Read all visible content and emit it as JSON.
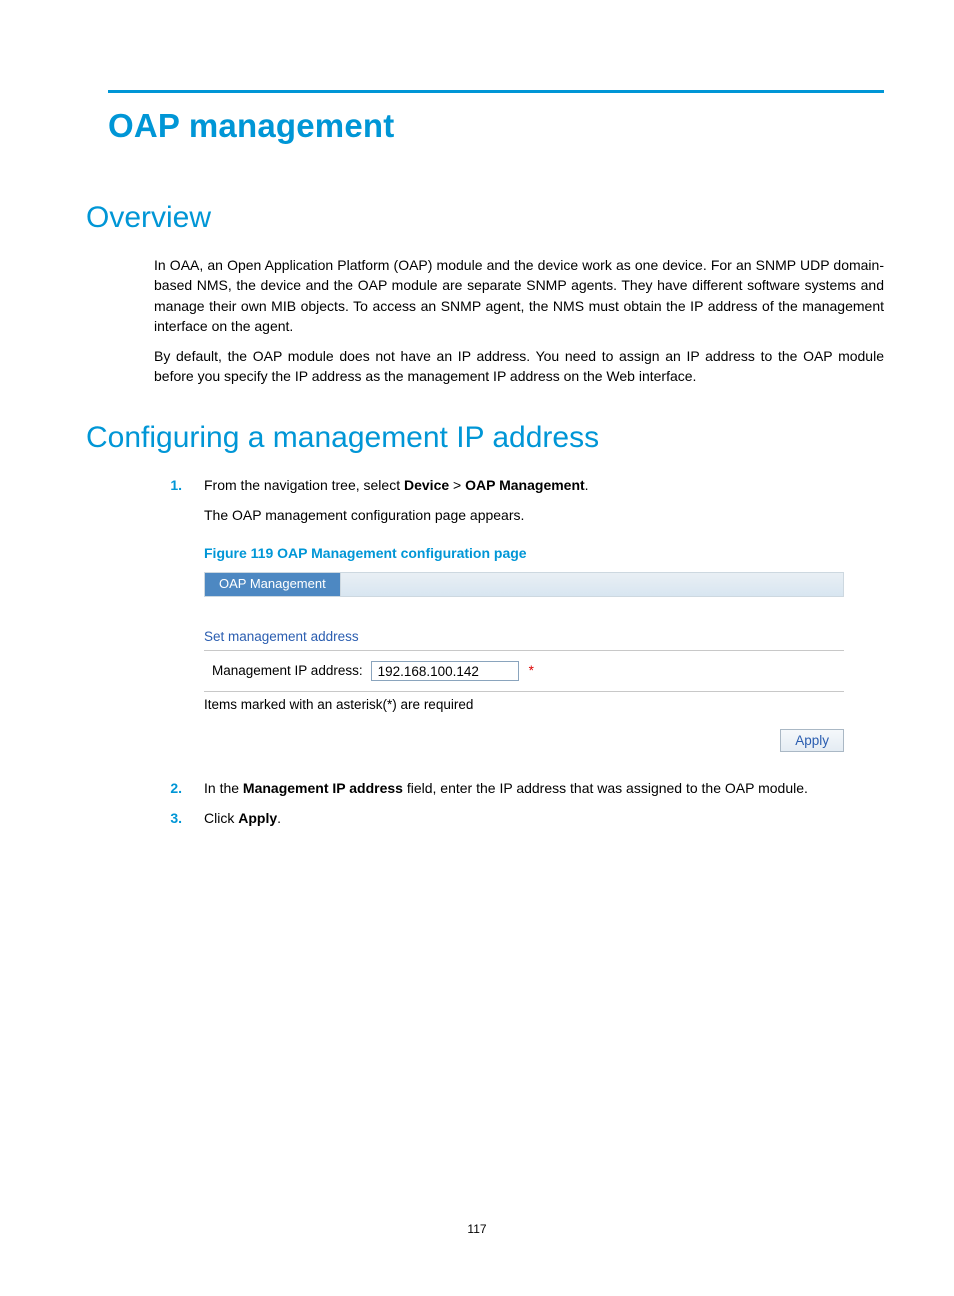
{
  "title": "OAP management",
  "sections": {
    "overview": {
      "heading": "Overview",
      "p1": "In OAA, an Open Application Platform (OAP) module and the device work as one device. For an SNMP UDP domain-based NMS, the device and the OAP module are separate SNMP agents. They have different software systems and manage their own MIB objects. To access an SNMP agent, the NMS must obtain the IP address of the management interface on the agent.",
      "p2": "By default, the OAP module does not have an IP address. You need to assign an IP address to the OAP module before you specify the IP address as the management IP address on the Web interface."
    },
    "config": {
      "heading": "Configuring a management IP address",
      "steps": {
        "s1_pre": "From the navigation tree, select ",
        "s1_b1": "Device",
        "s1_sep": " > ",
        "s1_b2": "OAP Management",
        "s1_suf": ".",
        "s1_sub": "The OAP management configuration page appears.",
        "figcap": "Figure 119 OAP Management configuration page",
        "s2_pre": "In the ",
        "s2_b": "Management IP address",
        "s2_suf": " field, enter the IP address that was assigned to the OAP module.",
        "s3_pre": "Click ",
        "s3_b": "Apply",
        "s3_suf": "."
      }
    }
  },
  "figure": {
    "tab": "OAP Management",
    "section_title": "Set management address",
    "field_label": "Management IP address:",
    "ip_value": "192.168.100.142",
    "req_mark": "*",
    "req_note": "Items marked with an asterisk(*) are required",
    "apply": "Apply"
  },
  "page_number": "117"
}
